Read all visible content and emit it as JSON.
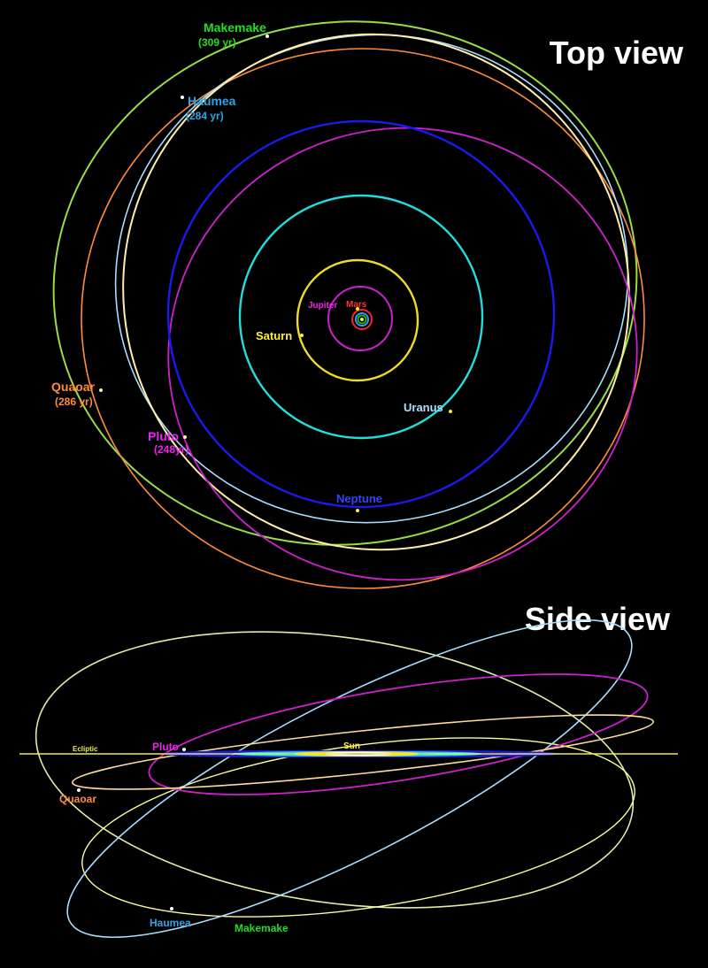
{
  "headings": {
    "top": "Top view",
    "side": "Side view"
  },
  "top_view": {
    "bodies": {
      "makemake": {
        "name": "Makemake",
        "period": "(309 yr)",
        "color": "#22dd22",
        "orbit_color": "#99dd44"
      },
      "haumea": {
        "name": "Haumea",
        "period": "(284 yr)",
        "color": "#2aa6e8",
        "orbit_color": "#aaddff"
      },
      "quaoar": {
        "name": "Quaoar",
        "period": "(286 yr)",
        "color": "#ff8c3a",
        "orbit_color": "#ff8c3a"
      },
      "pluto": {
        "name": "Pluto",
        "period": "(248yr)",
        "color": "#ee22ee",
        "orbit_color": "#cc22cc"
      },
      "neptune": {
        "name": "Neptune",
        "color": "#3344ff",
        "orbit_color": "#1a1aee"
      },
      "uranus": {
        "name": "Uranus",
        "color": "#aaddff",
        "orbit_color": "#22dddd"
      },
      "saturn": {
        "name": "Saturn",
        "color": "#ffee33",
        "orbit_color": "#eedd22"
      },
      "jupiter": {
        "name": "Jupiter",
        "color": "#ee22ee",
        "orbit_color": "#cc22cc"
      },
      "mars": {
        "name": "Mars",
        "color": "#ff3333",
        "orbit_color": "#ff2222"
      }
    }
  },
  "side_view": {
    "ecliptic": "Ecliptic",
    "sun": "Sun",
    "pluto": "Pluto",
    "quaoar": "Quaoar",
    "haumea": "Haumea",
    "makemake": "Makemake"
  }
}
